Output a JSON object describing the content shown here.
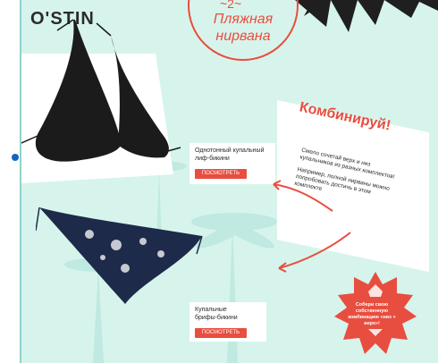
{
  "brand": {
    "logo": "O'STIN"
  },
  "hero": {
    "number": "~2~",
    "title_line1": "Пляжная",
    "title_line2": "нирвана"
  },
  "products": [
    {
      "title_line1": "Однотонный купальный",
      "title_line2": "лиф-бикини",
      "button": "ПОСМОТРЕТЬ"
    },
    {
      "title_line1": "Купальные",
      "title_line2": "брифы-бикини",
      "button": "ПОСМОТРЕТЬ"
    }
  ],
  "promo": {
    "heading": "Комбинируй!",
    "paragraph1": "Смело сочетай верх и низ купальников из разных комплектов!",
    "paragraph2": "Например, полной нирваны можно попробовать достичь в этом комплекте"
  },
  "badge": {
    "text": "Собери свою собственную комбинацию «низ + верх»!"
  },
  "colors": {
    "accent": "#e84e3f",
    "background": "#d7f4ec",
    "dark": "#2b2b2b"
  }
}
